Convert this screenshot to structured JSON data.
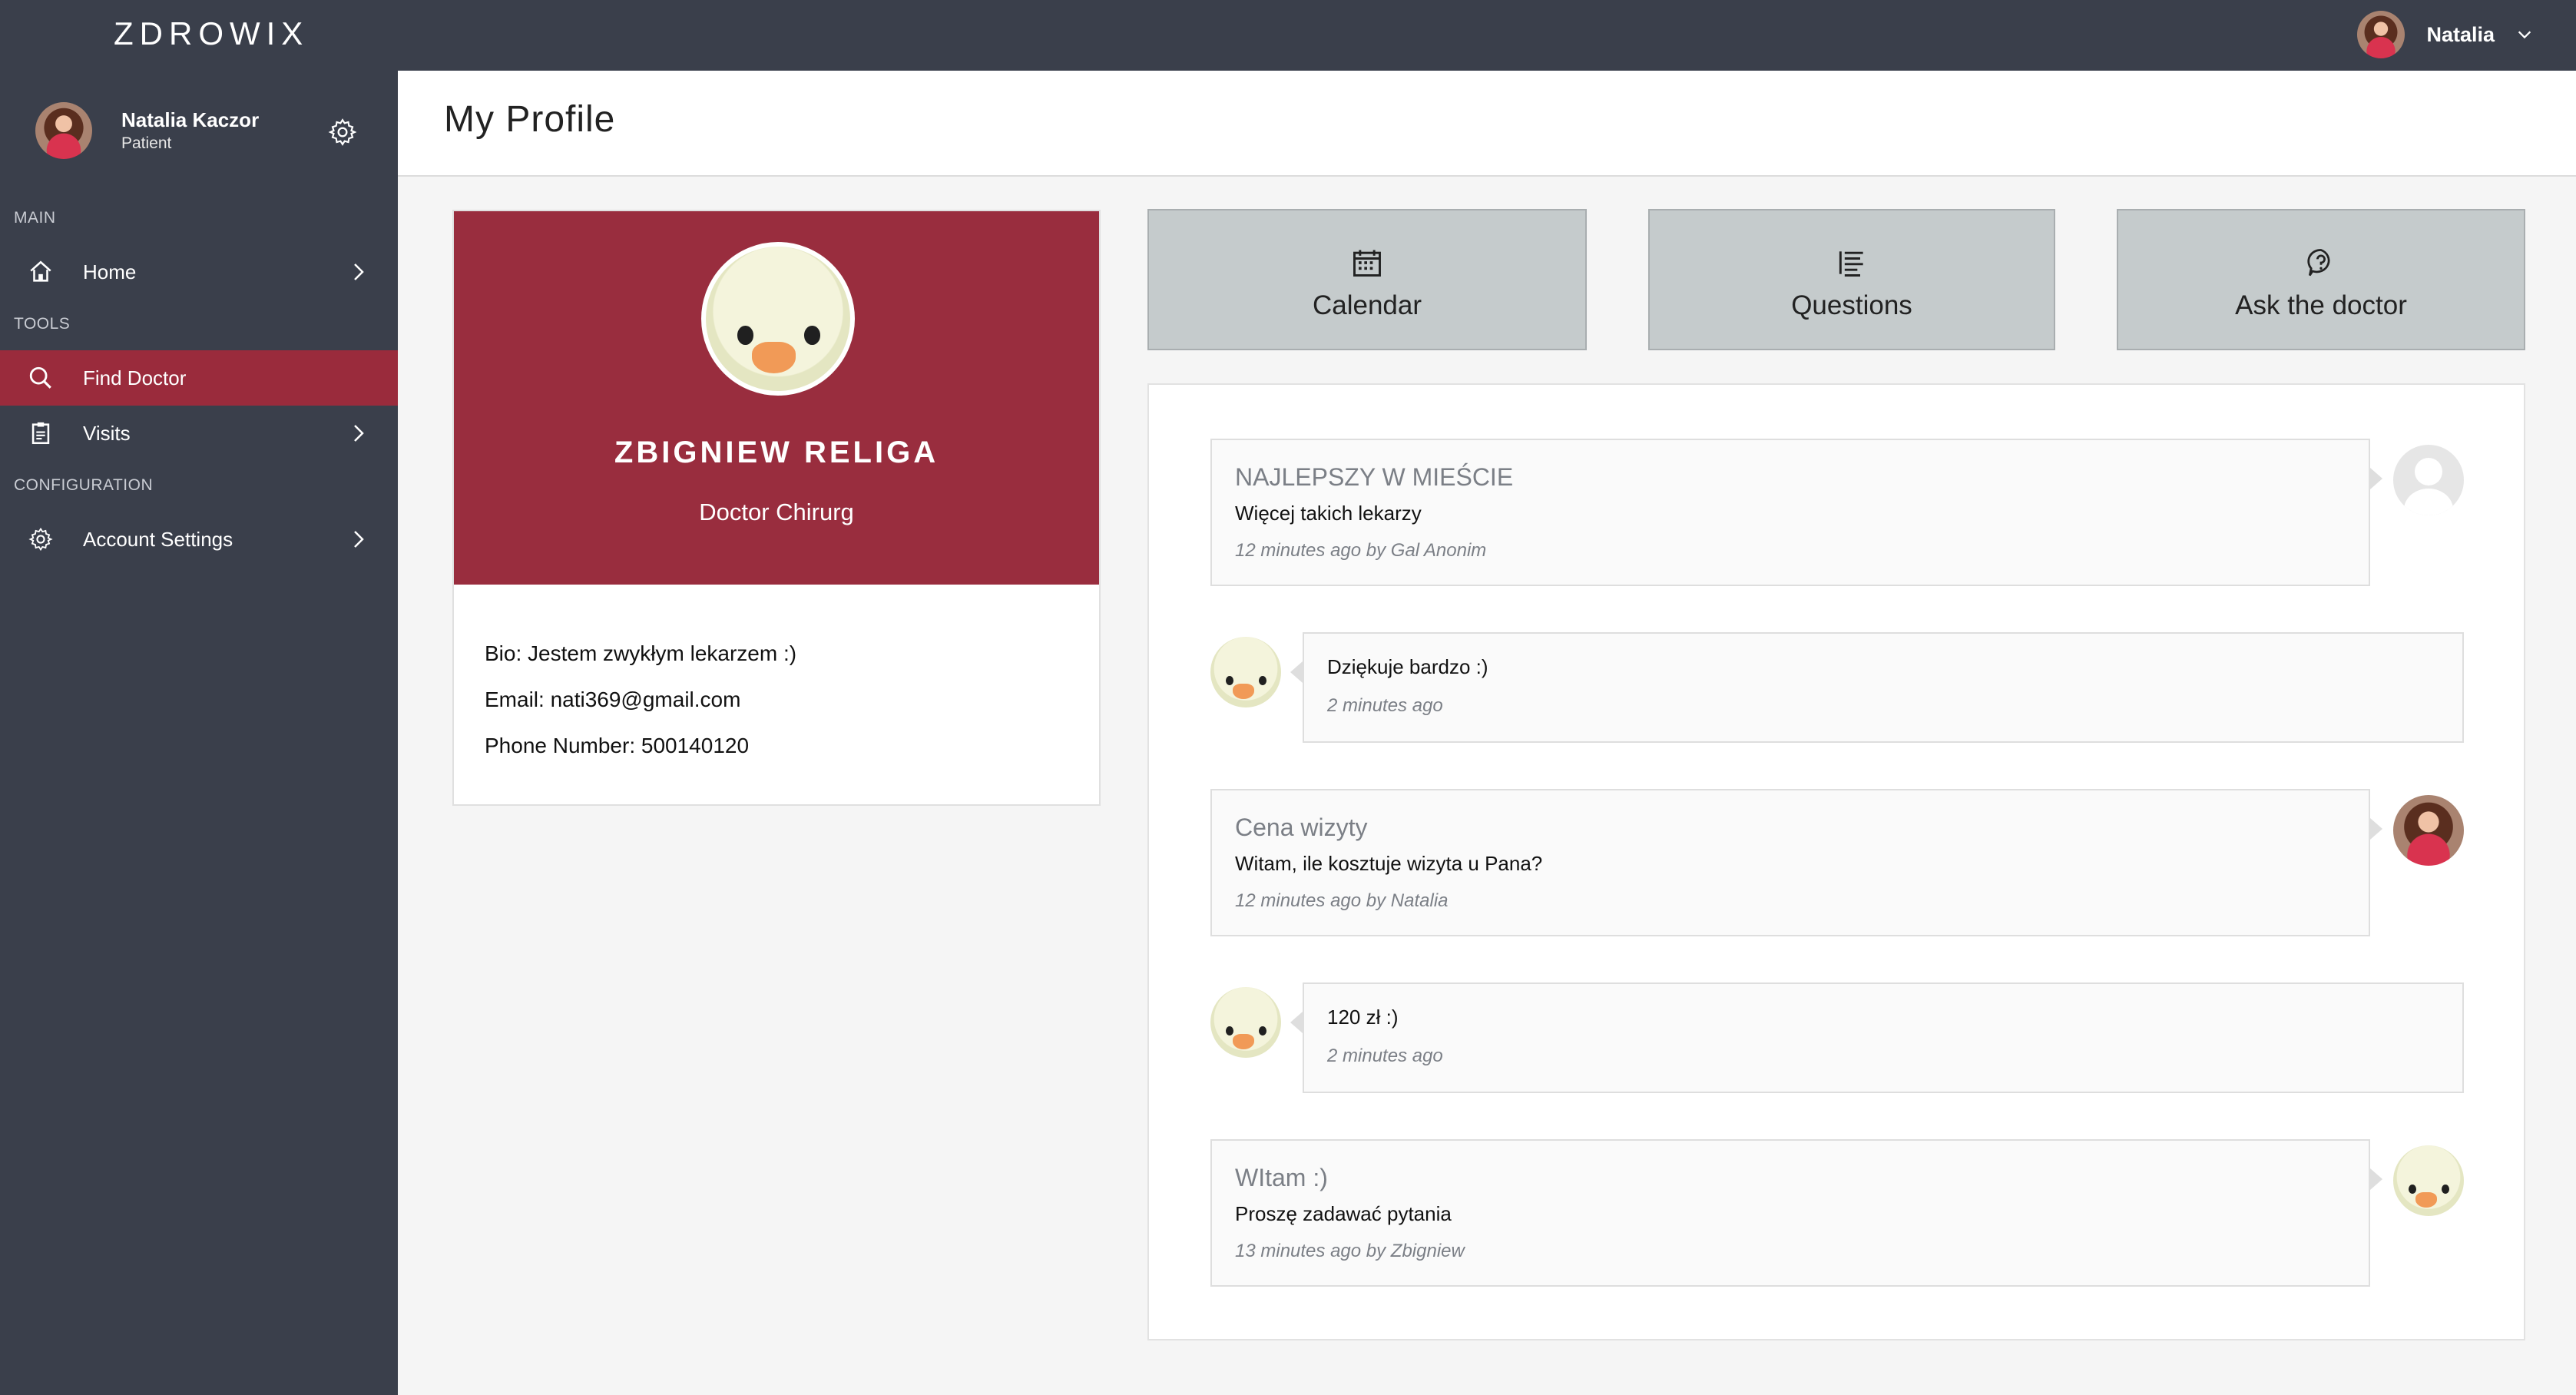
{
  "app": {
    "brand": "ZDROWIX"
  },
  "topbar": {
    "user_name": "Natalia"
  },
  "sidebar": {
    "user": {
      "name": "Natalia Kaczor",
      "role": "Patient"
    },
    "sections": {
      "main": "MAIN",
      "tools": "TOOLS",
      "configuration": "CONFIGURATION"
    },
    "items": {
      "home": "Home",
      "find_doctor": "Find Doctor",
      "visits": "Visits",
      "account_settings": "Account Settings"
    }
  },
  "page": {
    "title": "My Profile"
  },
  "profile": {
    "name": "ZBIGNIEW RELIGA",
    "specialty": "Doctor Chirurg",
    "bio": "Bio: Jestem zwykłym lekarzem :)",
    "email": "Email: nati369@gmail.com",
    "phone": "Phone Number: 500140120"
  },
  "actions": {
    "calendar": "Calendar",
    "questions": "Questions",
    "ask": "Ask the doctor"
  },
  "messages": [
    {
      "title": "NAJLEPSZY W MIEŚCIE",
      "text": "Więcej takich lekarzy",
      "meta": "12 minutes ago by Gal Anonim"
    },
    {
      "text": "Dziękuje bardzo :)",
      "meta": "2 minutes ago"
    },
    {
      "title": "Cena wizyty",
      "text": "Witam, ile kosztuje wizyta u Pana?",
      "meta": "12 minutes ago by Natalia"
    },
    {
      "text": "120 zł :)",
      "meta": "2 minutes ago"
    },
    {
      "title": "WItam :)",
      "text": "Proszę zadawać pytania",
      "meta": "13 minutes ago by Zbigniew"
    }
  ],
  "colors": {
    "sidebar_bg": "#3a3f4b",
    "accent": "#9a2b3c",
    "profile_header": "#992d3e",
    "action_button": "#c5cbcc"
  }
}
